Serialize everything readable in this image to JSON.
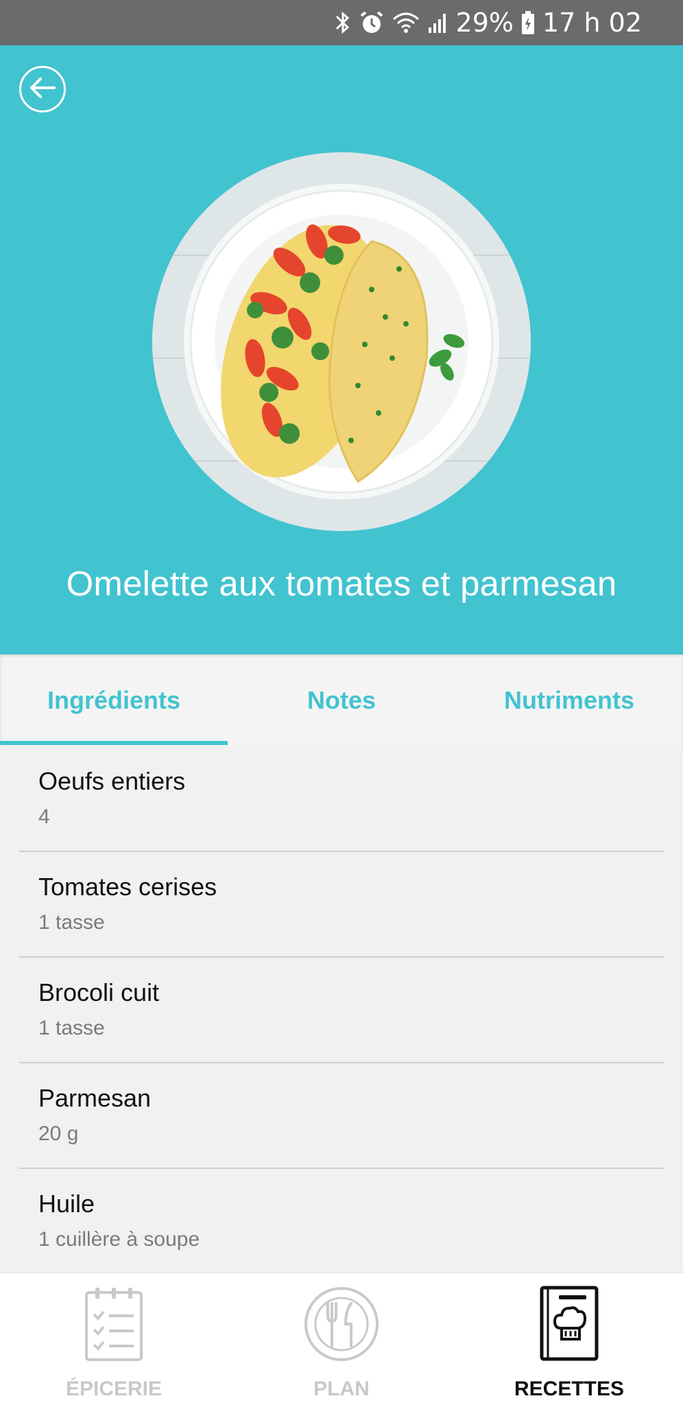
{
  "status_bar": {
    "battery_percent": "29%",
    "time": "17 h 02",
    "icons": [
      "bluetooth-icon",
      "alarm-icon",
      "wifi-icon",
      "signal-icon",
      "battery-icon"
    ]
  },
  "header": {
    "back_icon": "arrow-left-icon",
    "recipe_title": "Omelette aux tomates et parmesan"
  },
  "tabs": [
    {
      "label": "Ingrédients",
      "active": true
    },
    {
      "label": "Notes",
      "active": false
    },
    {
      "label": "Nutriments",
      "active": false
    }
  ],
  "ingredients": [
    {
      "name": "Oeufs entiers",
      "qty": "4"
    },
    {
      "name": "Tomates cerises",
      "qty": "1 tasse"
    },
    {
      "name": "Brocoli cuit",
      "qty": "1 tasse"
    },
    {
      "name": "Parmesan",
      "qty": "20 g"
    },
    {
      "name": "Huile",
      "qty": "1 cuillère à soupe"
    }
  ],
  "bottom_nav": [
    {
      "label": "ÉPICERIE",
      "icon": "grocery-list-icon",
      "active": false
    },
    {
      "label": "PLAN",
      "icon": "fork-knife-plate-icon",
      "active": false
    },
    {
      "label": "RECETTES",
      "icon": "recipe-book-icon",
      "active": true
    }
  ],
  "colors": {
    "accent": "#42c3d0",
    "status_bar": "#6b6b6b",
    "inactive_nav": "#c9c9c9",
    "active_nav": "#111111"
  }
}
